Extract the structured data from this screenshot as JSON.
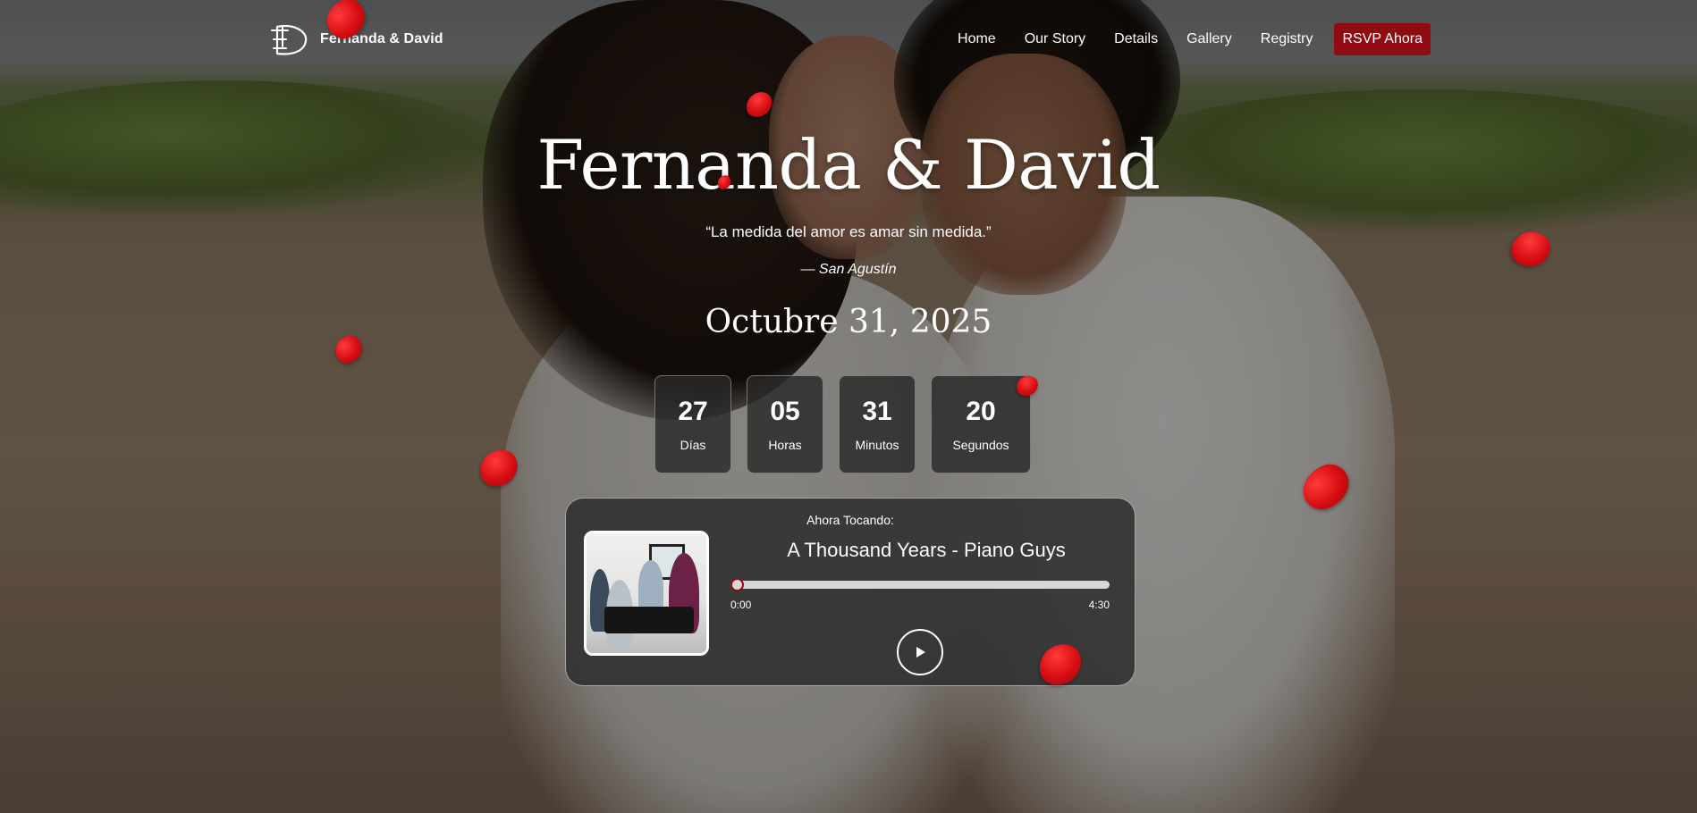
{
  "brand": {
    "name": "Fernanda & David",
    "logo_icon": "fd-monogram-icon"
  },
  "nav": {
    "links": [
      "Home",
      "Our Story",
      "Details",
      "Gallery",
      "Registry"
    ],
    "rsvp_label": "RSVP Ahora"
  },
  "hero": {
    "title": "Fernanda & David",
    "quote": "“La medida del amor es amar sin medida.”",
    "attribution": "— San Agustín",
    "date": "Octubre 31, 2025"
  },
  "countdown": [
    {
      "value": "27",
      "label": "Días"
    },
    {
      "value": "05",
      "label": "Horas"
    },
    {
      "value": "31",
      "label": "Minutos"
    },
    {
      "value": "20",
      "label": "Segundos"
    }
  ],
  "player": {
    "heading": "Ahora Tocando:",
    "track_title": "A Thousand Years - Piano Guys",
    "current_time": "0:00",
    "total_time": "4:30",
    "progress": 0,
    "play_icon": "play-icon"
  },
  "colors": {
    "accent": "#8e0c12",
    "petal": "#d50d12",
    "card_bg": "#2d2d2d"
  }
}
